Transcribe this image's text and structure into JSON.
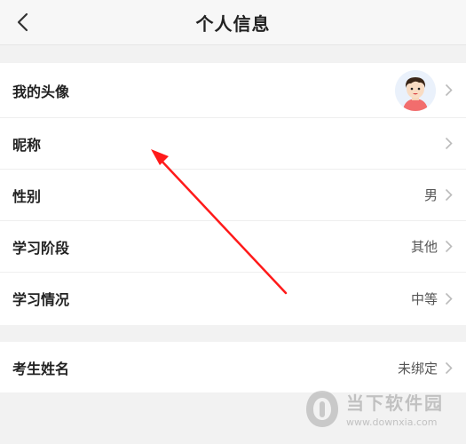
{
  "header": {
    "title": "个人信息"
  },
  "profile": {
    "rows": [
      {
        "label": "我的头像",
        "value": ""
      },
      {
        "label": "昵称",
        "value": ""
      },
      {
        "label": "性别",
        "value": "男"
      },
      {
        "label": "学习阶段",
        "value": "其他"
      },
      {
        "label": "学习情况",
        "value": "中等"
      }
    ]
  },
  "binding": {
    "rows": [
      {
        "label": "考生姓名",
        "value": "未绑定"
      }
    ]
  },
  "watermark": {
    "name": "当下软件园",
    "url": "www.downxia.com"
  },
  "colors": {
    "annotation_arrow": "#ff1a1a",
    "background": "#f2f2f2"
  }
}
